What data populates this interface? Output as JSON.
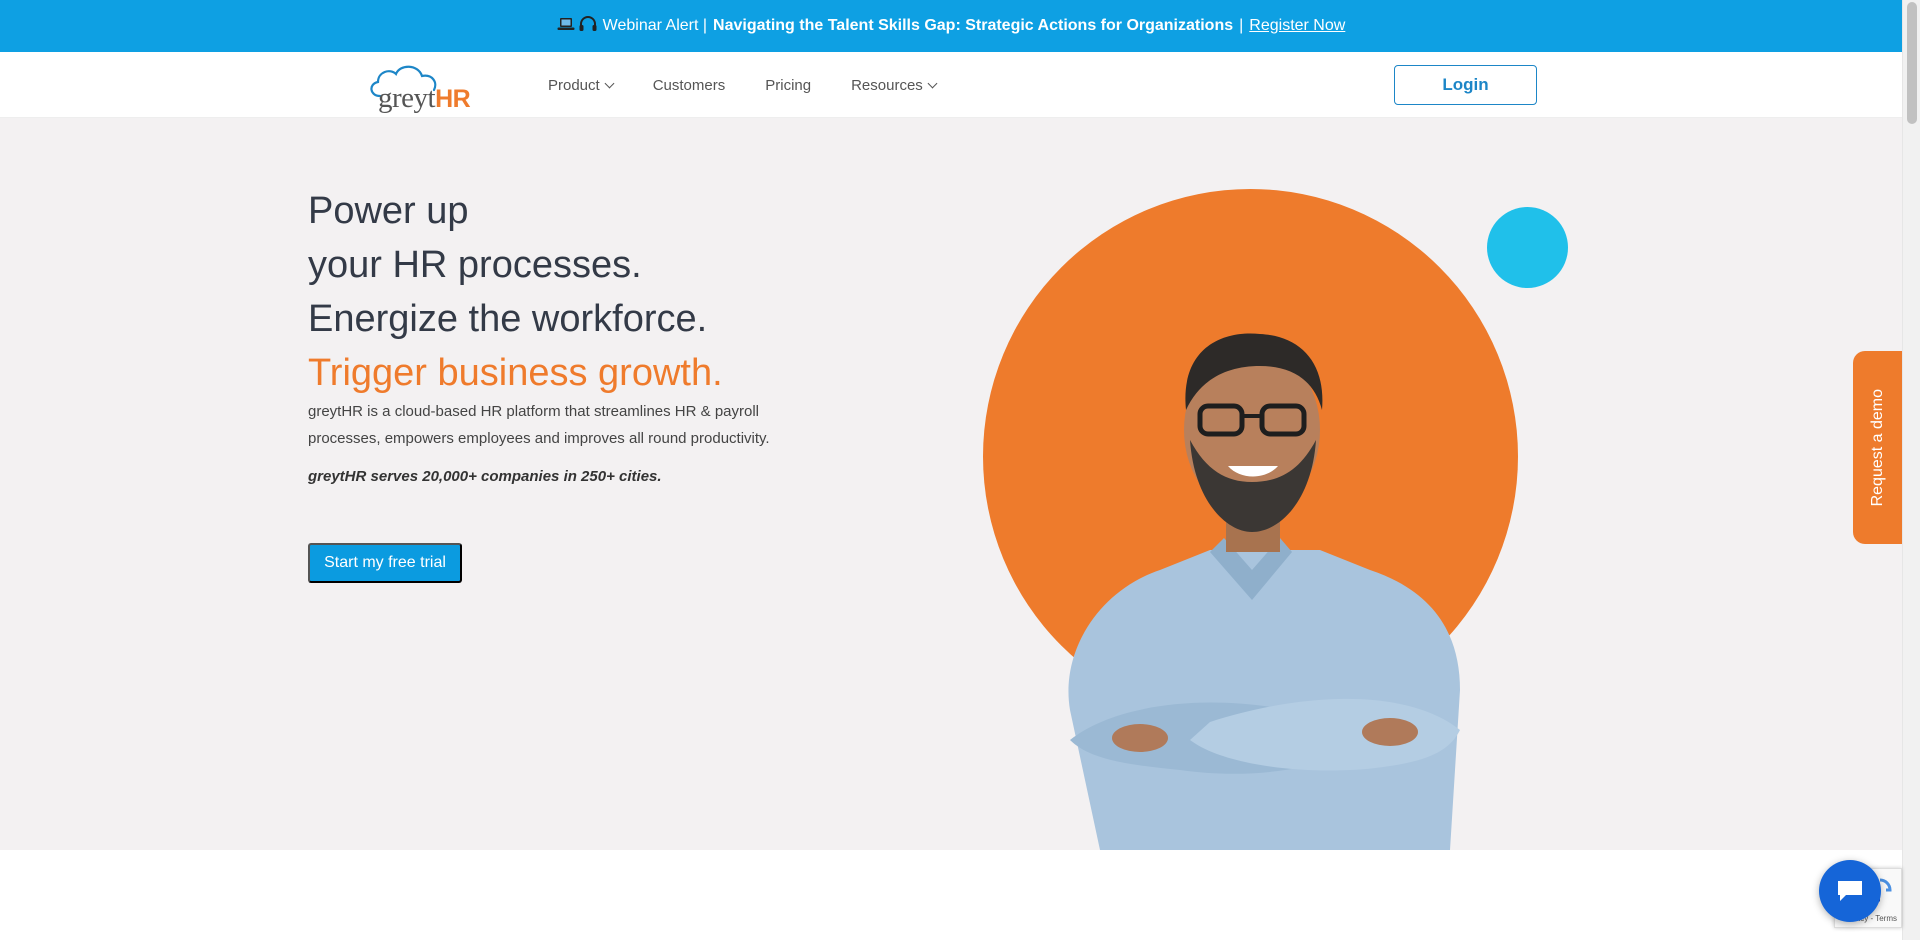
{
  "announcement": {
    "icon_names": [
      "laptop-icon",
      "headphones-icon"
    ],
    "prefix": "Webinar Alert |",
    "bold_text": "Navigating the Talent Skills Gap: Strategic Actions for Organizations",
    "separator": "|",
    "link_text": "Register Now"
  },
  "header": {
    "logo": {
      "grey": "greyt",
      "accent": "HR"
    },
    "nav": [
      {
        "label": "Product",
        "has_dropdown": true
      },
      {
        "label": "Customers",
        "has_dropdown": false
      },
      {
        "label": "Pricing",
        "has_dropdown": false
      },
      {
        "label": "Resources",
        "has_dropdown": true
      }
    ],
    "login_label": "Login"
  },
  "hero": {
    "headline_lines": [
      "Power up",
      "your HR processes.",
      "Energize the workforce."
    ],
    "headline_accent": "Trigger business growth.",
    "description": "greytHR is a cloud-based HR platform that streamlines HR & payroll processes, empowers employees and improves all round productivity.",
    "serves": "greytHR serves 20,000+ companies in 250+ cities.",
    "cta_label": "Start my free trial"
  },
  "side_tab": {
    "label": "Request a demo"
  },
  "recaptcha": {
    "text": "Privacy - Terms"
  },
  "colors": {
    "announce_bg": "#0ea0e3",
    "brand_orange": "#ee7b2c",
    "brand_blue": "#0b9be0",
    "accent_cyan": "#20c0ea",
    "hero_bg": "#f3f1f2"
  }
}
